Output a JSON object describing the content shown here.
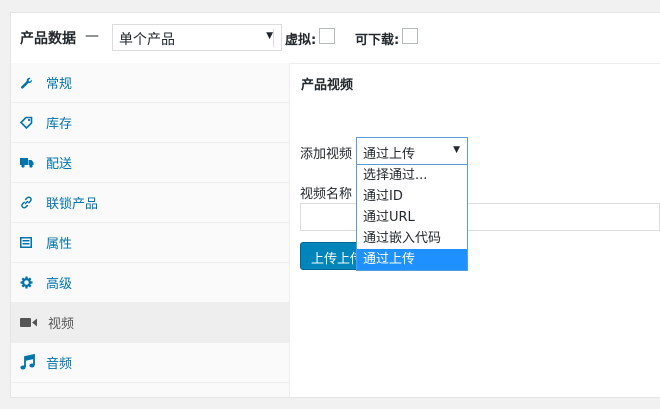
{
  "header": {
    "title": "产品数据",
    "dash": "—",
    "type_select": {
      "value": "单个产品"
    },
    "virtual_label": "虚拟:",
    "downloadable_label": "可下载:"
  },
  "sidebar": {
    "items": [
      {
        "label": "常规",
        "icon": "wrench-icon"
      },
      {
        "label": "库存",
        "icon": "tag-icon"
      },
      {
        "label": "配送",
        "icon": "truck-icon"
      },
      {
        "label": "联锁产品",
        "icon": "link-icon"
      },
      {
        "label": "属性",
        "icon": "list-icon"
      },
      {
        "label": "高级",
        "icon": "gear-icon"
      },
      {
        "label": "视频",
        "icon": "video-camera-icon"
      },
      {
        "label": "音频",
        "icon": "music-note-icon"
      }
    ],
    "active_index": 6
  },
  "main": {
    "title": "产品视频",
    "add_video_label": "添加视频",
    "video_select": {
      "value": "通过上传",
      "options": [
        "选择通过...",
        "通过ID",
        "通过URL",
        "通过嵌入代码",
        "通过上传"
      ],
      "selected_index": 4
    },
    "video_name_label": "视频名称",
    "upload_button": "上传上传"
  },
  "colors": {
    "link": "#0073aa",
    "button": "#0085ba",
    "dropdown_highlight": "#1e90ff",
    "focus_border": "#5b9dd9"
  }
}
